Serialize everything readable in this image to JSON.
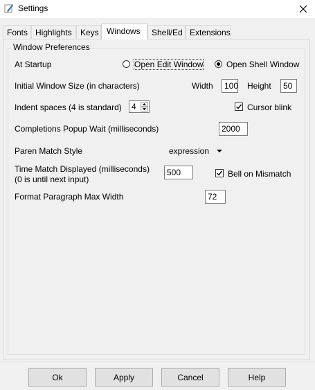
{
  "window": {
    "title": "Settings"
  },
  "tabs": [
    "Fonts",
    "Highlights",
    "Keys",
    "Windows",
    "Shell/Ed",
    "Extensions"
  ],
  "active_tab": "Windows",
  "group": {
    "legend": "Window Preferences"
  },
  "startup": {
    "label": "At Startup",
    "option_edit": "Open Edit Window",
    "option_shell": "Open Shell Window",
    "selected": "Open Shell Window"
  },
  "window_size": {
    "label": "Initial Window Size  (in characters)",
    "width_label": "Width",
    "width_value": "100",
    "height_label": "Height",
    "height_value": "50"
  },
  "indent": {
    "label": "Indent spaces (4 is standard)",
    "value": "4"
  },
  "cursor_blink": {
    "label": "Cursor blink",
    "checked": true
  },
  "completions": {
    "label": "Completions Popup Wait (milliseconds)",
    "value": "2000"
  },
  "paren": {
    "label": "Paren Match Style",
    "value": "expression"
  },
  "time_match": {
    "label_line1": "Time Match Displayed (milliseconds)",
    "label_line2": "(0 is until next input)",
    "value": "500"
  },
  "bell": {
    "label": "Bell on Mismatch",
    "checked": true
  },
  "format": {
    "label": "Format Paragraph Max Width",
    "value": "72"
  },
  "buttons": {
    "ok": "Ok",
    "apply": "Apply",
    "cancel": "Cancel",
    "help": "Help"
  }
}
